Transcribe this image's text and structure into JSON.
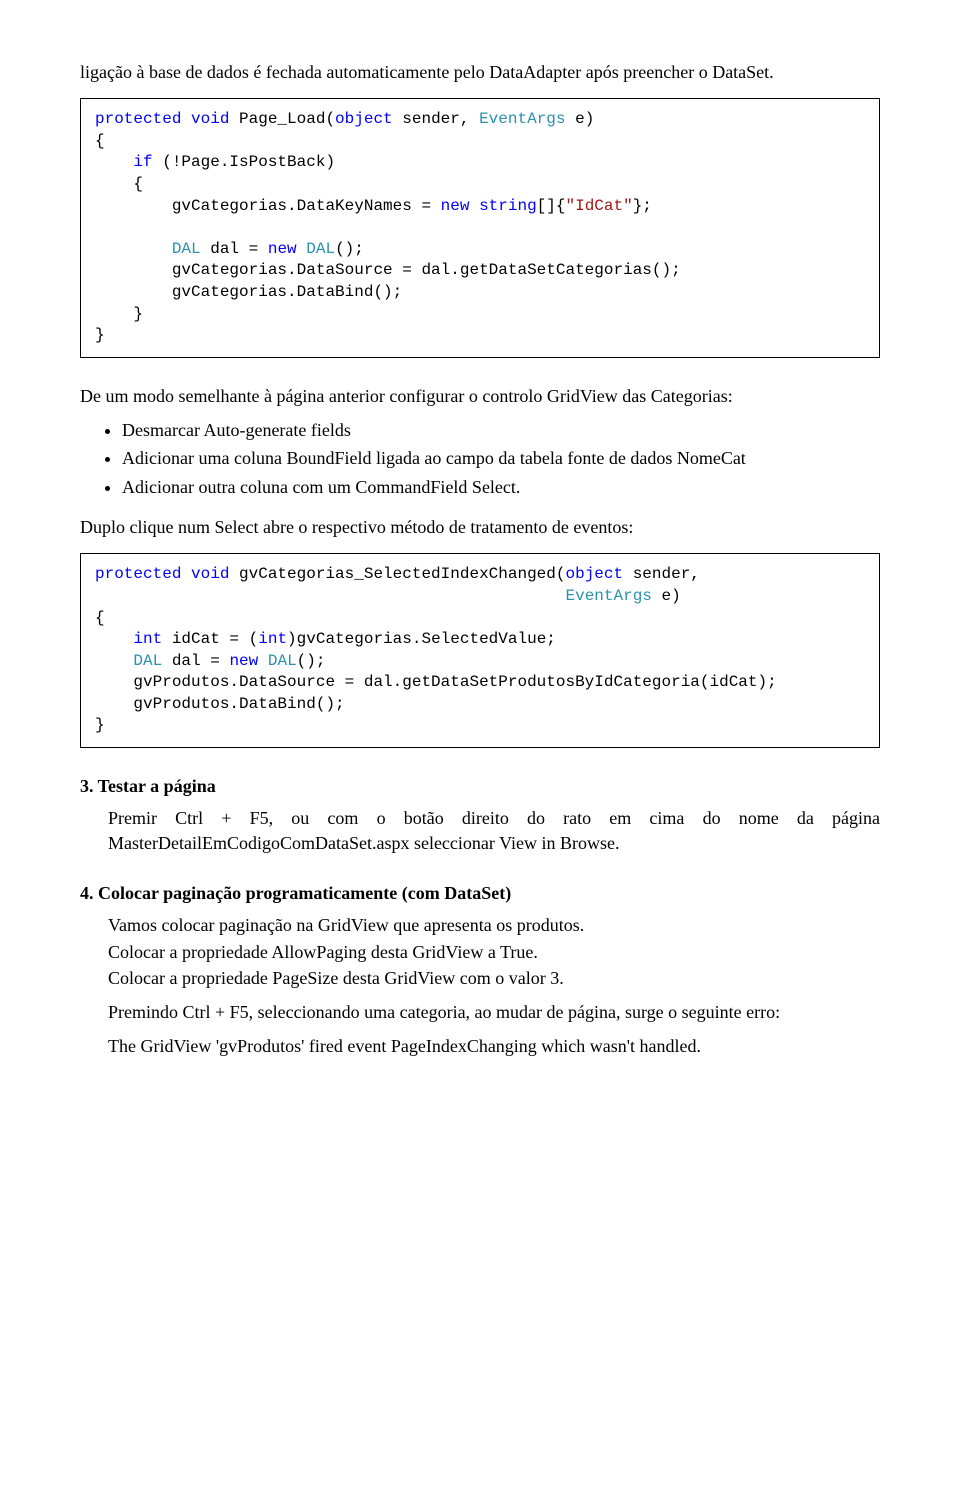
{
  "intro": "ligação à base de dados é fechada automaticamente pelo DataAdapter após preencher o DataSet.",
  "code1": {
    "l1a": "protected void",
    "l1b": " Page_Load(",
    "l1c": "object",
    "l1d": " sender, ",
    "l1e": "EventArgs",
    "l1f": " e)",
    "l2": "{",
    "l3a": "    if",
    "l3b": " (!Page.IsPostBack)",
    "l4": "    {",
    "l5a": "        gvCategorias.DataKeyNames = ",
    "l5b": "new string",
    "l5c": "[]{",
    "l5d": "\"IdCat\"",
    "l5e": "};",
    "blank": "",
    "l6a": "        DAL",
    "l6b": " dal = ",
    "l6c": "new",
    "l6d": " ",
    "l6e": "DAL",
    "l6f": "();",
    "l7": "        gvCategorias.DataSource = dal.getDataSetCategorias();",
    "l8": "        gvCategorias.DataBind();",
    "l9": "    }",
    "l10": "}"
  },
  "para2": "De um modo semelhante à página anterior configurar o controlo GridView das Categorias:",
  "bullets": [
    "Desmarcar Auto-generate fields",
    "Adicionar uma coluna BoundField ligada ao campo da tabela fonte de dados NomeCat",
    "Adicionar outra coluna com um CommandField Select."
  ],
  "para3": "Duplo clique num Select abre o respectivo método de tratamento de eventos:",
  "code2": {
    "l1a": "protected void",
    "l1b": " gvCategorias_SelectedIndexChanged(",
    "l1c": "object",
    "l1d": " sender,",
    "l1e": "                                                 ",
    "l1f": "EventArgs",
    "l1g": " e)",
    "l2": "{",
    "l3a": "    int",
    "l3b": " idCat = (",
    "l3c": "int",
    "l3d": ")gvCategorias.SelectedValue;",
    "l4a": "    DAL",
    "l4b": " dal = ",
    "l4c": "new",
    "l4d": " ",
    "l4e": "DAL",
    "l4f": "();",
    "l5": "    gvProdutos.DataSource = dal.getDataSetProdutosByIdCategoria(idCat);",
    "l6": "    gvProdutos.DataBind();",
    "l7": "}"
  },
  "sec3": {
    "title": "3.  Testar a página",
    "p1": "Premir Ctrl + F5,  ou  com o botão direito do rato em cima do nome da página MasterDetailEmCodigoComDataSet.aspx seleccionar View in Browse."
  },
  "sec4": {
    "title": "4.  Colocar paginação programaticamente (com DataSet)",
    "p1": "Vamos colocar paginação na GridView que apresenta os produtos.",
    "p2": "Colocar a propriedade AllowPaging desta GridView a True.",
    "p3": "Colocar a propriedade PageSize desta GridView com o valor 3.",
    "p4": "Premindo Ctrl + F5, seleccionando uma categoria, ao mudar de página, surge o seguinte erro:",
    "p5": "The GridView 'gvProdutos' fired event PageIndexChanging which wasn't handled."
  }
}
